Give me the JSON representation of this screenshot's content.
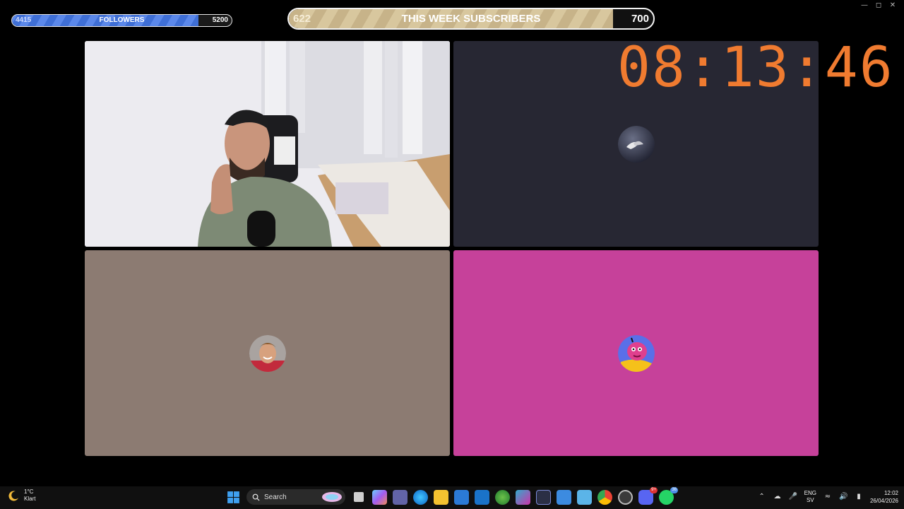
{
  "followers_bar": {
    "current": "4415",
    "label": "FOLLOWERS",
    "goal": "5200",
    "progress": 0.85
  },
  "subscribers_bar": {
    "current": "622",
    "label": "THIS WEEK SUBSCRIBERS",
    "goal": "700",
    "progress": 0.889
  },
  "timer": "08:13:46",
  "tiles": [
    {
      "name": "webcam-tile",
      "color": "#eceaef"
    },
    {
      "name": "moon-avatar-tile",
      "color": "#272733"
    },
    {
      "name": "person-avatar-tile",
      "color": "#8c7b72"
    },
    {
      "name": "cartoon-avatar-tile",
      "color": "#c6419a"
    }
  ],
  "taskbar": {
    "weather": {
      "temp": "1°C",
      "condition": "Klart"
    },
    "search_label": "Search",
    "discord_badge": "9+",
    "whatsapp_badge": "36",
    "language": {
      "lang": "ENG",
      "region": "SV"
    },
    "time": "12:02",
    "date": "26/04/2026"
  }
}
